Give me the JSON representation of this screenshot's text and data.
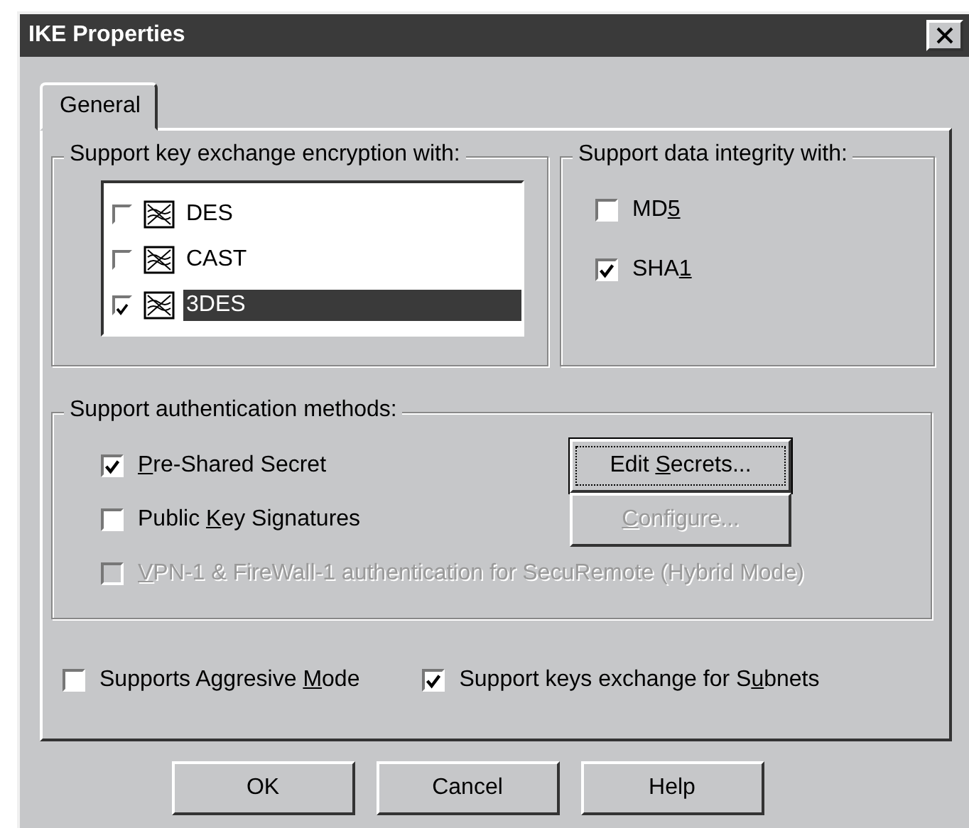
{
  "window": {
    "title": "IKE Properties"
  },
  "tabs": [
    {
      "label": "General",
      "selected": true
    }
  ],
  "encryption": {
    "label": "Support key exchange encryption with:",
    "items": [
      {
        "label": "DES",
        "checked": false,
        "selected": false
      },
      {
        "label": "CAST",
        "checked": false,
        "selected": false
      },
      {
        "label": "3DES",
        "checked": true,
        "selected": true
      }
    ]
  },
  "integrity": {
    "label": "Support data integrity with:",
    "items": [
      {
        "label": {
          "pre": "MD",
          "key": "5"
        },
        "checked": false
      },
      {
        "label": {
          "pre": "SHA",
          "key": "1"
        },
        "checked": true
      }
    ]
  },
  "authentication": {
    "label": "Support authentication methods:",
    "methods": [
      {
        "label": {
          "key": "P",
          "post": "re-Shared Secret"
        },
        "checked": true,
        "disabled": false,
        "button": {
          "label": {
            "pre": "Edit ",
            "key": "S",
            "post": "ecrets..."
          },
          "disabled": false,
          "focused": true
        }
      },
      {
        "label": {
          "pre": "Public ",
          "key": "K",
          "post": "ey Signatures"
        },
        "checked": false,
        "disabled": false,
        "button": {
          "label": {
            "key": "C",
            "post": "onfigure..."
          },
          "disabled": true,
          "focused": false
        }
      },
      {
        "label": {
          "key": "V",
          "post": "PN-1 & FireWall-1 authentication for SecuRemote (Hybrid Mode)"
        },
        "checked": false,
        "disabled": true
      }
    ]
  },
  "options": [
    {
      "label": {
        "pre": "Supports Aggresive ",
        "key": "M",
        "post": "ode"
      },
      "checked": false
    },
    {
      "label": {
        "pre": "Support keys exchange for S",
        "key": "u",
        "post": "bnets"
      },
      "checked": true
    }
  ],
  "buttons": [
    {
      "label": "OK"
    },
    {
      "label": "Cancel"
    },
    {
      "label": "Help"
    }
  ]
}
